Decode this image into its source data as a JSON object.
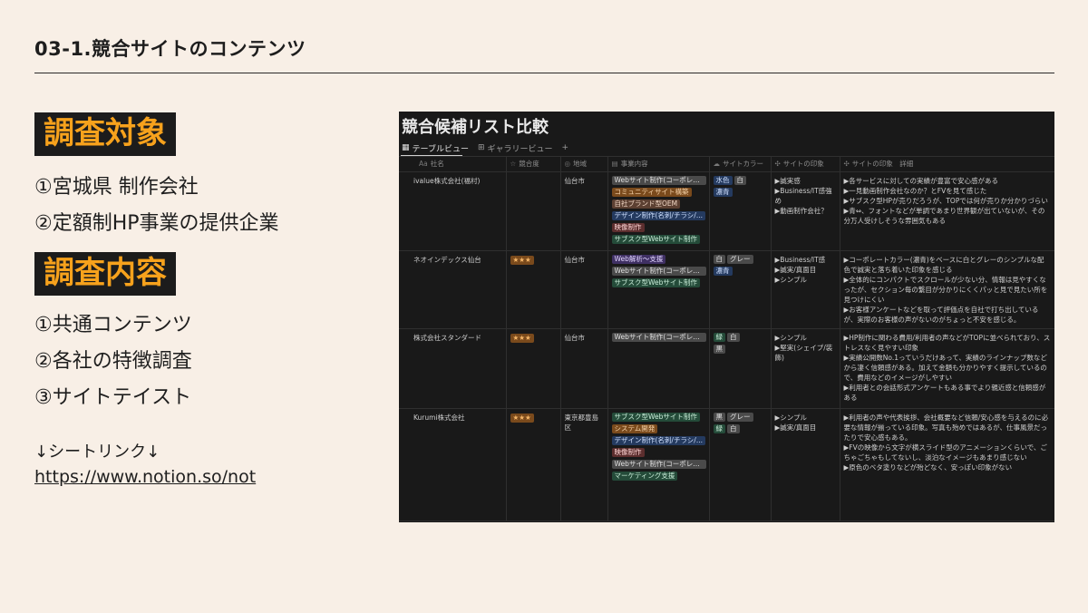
{
  "slide": {
    "title": "03-1.競合サイトのコンテンツ",
    "section1": "調査対象",
    "targets": [
      "①宮城県 制作会社",
      "②定額制HP事業の提供企業"
    ],
    "section2": "調査内容",
    "contents": [
      "①共通コンテンツ",
      "②各社の特徴調査",
      "③サイトテイスト"
    ],
    "link_label": "↓シートリンク↓",
    "link_url": "https://www.notion.so/not"
  },
  "notion": {
    "title": "競合候補リスト比較",
    "tabs": [
      "テーブルビュー",
      "ギャラリービュー",
      "+"
    ],
    "columns": [
      "社名",
      "競合度",
      "地域",
      "事業内容",
      "サイトカラー",
      "サイトの印象",
      "サイトの印象　詳細"
    ],
    "rows": [
      {
        "name": "ivalue株式会社(福村)",
        "rating": "",
        "area": "仙台市",
        "business": [
          {
            "label": "Webサイト制作(コーポレー...",
            "color": "t-gray"
          },
          {
            "label": "コミュニティサイト構築",
            "color": "t-orange"
          },
          {
            "label": "自社ブランド型OEM",
            "color": "t-brown"
          },
          {
            "label": "デザイン制作(名刺/チラシ/...",
            "color": "t-blue"
          },
          {
            "label": "映像制作",
            "color": "t-red"
          },
          {
            "label": "サブスク型Webサイト制作",
            "color": "t-green"
          }
        ],
        "colors": [
          {
            "label": "水色",
            "color": "t-blue"
          },
          {
            "label": "白",
            "color": "t-gray"
          },
          {
            "label": "濃青",
            "color": "t-blue"
          }
        ],
        "impression": [
          "▶誠実感",
          "▶Business/IT感強め",
          "▶動画制作会社？"
        ],
        "detail": [
          "▶各サービスに対しての実績が豊富で安心感がある",
          "▶一見動画制作会社なのか？とFVを見て感じた",
          "▶サブスク型HPが売りだろうが、TOPでは何が売りか分かりづらい",
          "▶青⇔、フォントなどが単調であまり世界観が出ていないが、その分万人受けしそうな雰囲気もある"
        ]
      },
      {
        "name": "ネオインデックス仙台",
        "rating": "★★★",
        "area": "仙台市",
        "business": [
          {
            "label": "Web解析〜支援",
            "color": "t-purple"
          },
          {
            "label": "Webサイト制作(コーポレー...",
            "color": "t-gray"
          },
          {
            "label": "サブスク型Webサイト制作",
            "color": "t-green"
          }
        ],
        "colors": [
          {
            "label": "白",
            "color": "t-gray"
          },
          {
            "label": "グレー",
            "color": "t-gray"
          },
          {
            "label": "濃青",
            "color": "t-blue"
          }
        ],
        "impression": [
          "▶Business/IT感",
          "▶誠実/真面目",
          "▶シンプル"
        ],
        "detail": [
          "▶コーポレートカラー(濃青)をベースに白とグレーのシンプルな配色で誠実と落ち着いた印象を感じる",
          "▶全体的にコンパクトでスクロールが少ない分、情報は見やすくなったが、セクション毎の繋目が分かりにくくパッと見で見たい所を見つけにくい",
          "▶お客様アンケートなどを取って評価点を自社で打ち出しているが、実際のお客様の声がないのがちょっと不安を感じる。"
        ]
      },
      {
        "name": "株式会社スタンダード",
        "rating": "★★★",
        "area": "仙台市",
        "business": [
          {
            "label": "Webサイト制作(コーポレー...",
            "color": "t-gray"
          }
        ],
        "colors": [
          {
            "label": "緑",
            "color": "t-green"
          },
          {
            "label": "白",
            "color": "t-gray"
          },
          {
            "label": "黒",
            "color": "t-gray"
          }
        ],
        "impression": [
          "▶シンプル",
          "▶堅実(シェイプ/装飾)"
        ],
        "detail": [
          "▶HP制作に関わる費用/利用者の声などがTOPに並べられており、ストレスなく見やすい印象",
          "▶実績公開数No.1っていうだけあって、実績のラインナップ数などから凄く信頼感がある。加えて金額も分かりやすく提示しているので、費用などのイメージがしやすい",
          "▶利用者との会話形式アンケートもある事でより親近感と信頼感がある"
        ]
      },
      {
        "name": "Kurumi株式会社",
        "rating": "★★★",
        "area": "東京都豊島区",
        "business": [
          {
            "label": "サブスク型Webサイト制作",
            "color": "t-green"
          },
          {
            "label": "システム開発",
            "color": "t-orange"
          },
          {
            "label": "デザイン制作(名刺/チラシ/...",
            "color": "t-blue"
          },
          {
            "label": "映像制作",
            "color": "t-red"
          },
          {
            "label": "Webサイト制作(コーポレー...",
            "color": "t-gray"
          },
          {
            "label": "マーケティング支援",
            "color": "t-green"
          }
        ],
        "colors": [
          {
            "label": "黒",
            "color": "t-gray"
          },
          {
            "label": "グレー",
            "color": "t-gray"
          },
          {
            "label": "緑",
            "color": "t-green"
          },
          {
            "label": "白",
            "color": "t-gray"
          }
        ],
        "impression": [
          "▶シンプル",
          "▶誠実/真面目"
        ],
        "detail": [
          "▶利用者の声や代表挨拶、会社概要など信頼/安心感を与えるのに必要な情報が揃っている印象。写真も殆めではあるが、仕事風景だったりで安心感もある。",
          "▶FVの映像から文字が横スライド型のアニメーションくらいで、ごちゃごちゃもしてないし、淡泊なイメージもあまり感じない",
          "▶原色のベタ塗りなどが殆どなく、安っぽい印象がない"
        ]
      }
    ]
  }
}
